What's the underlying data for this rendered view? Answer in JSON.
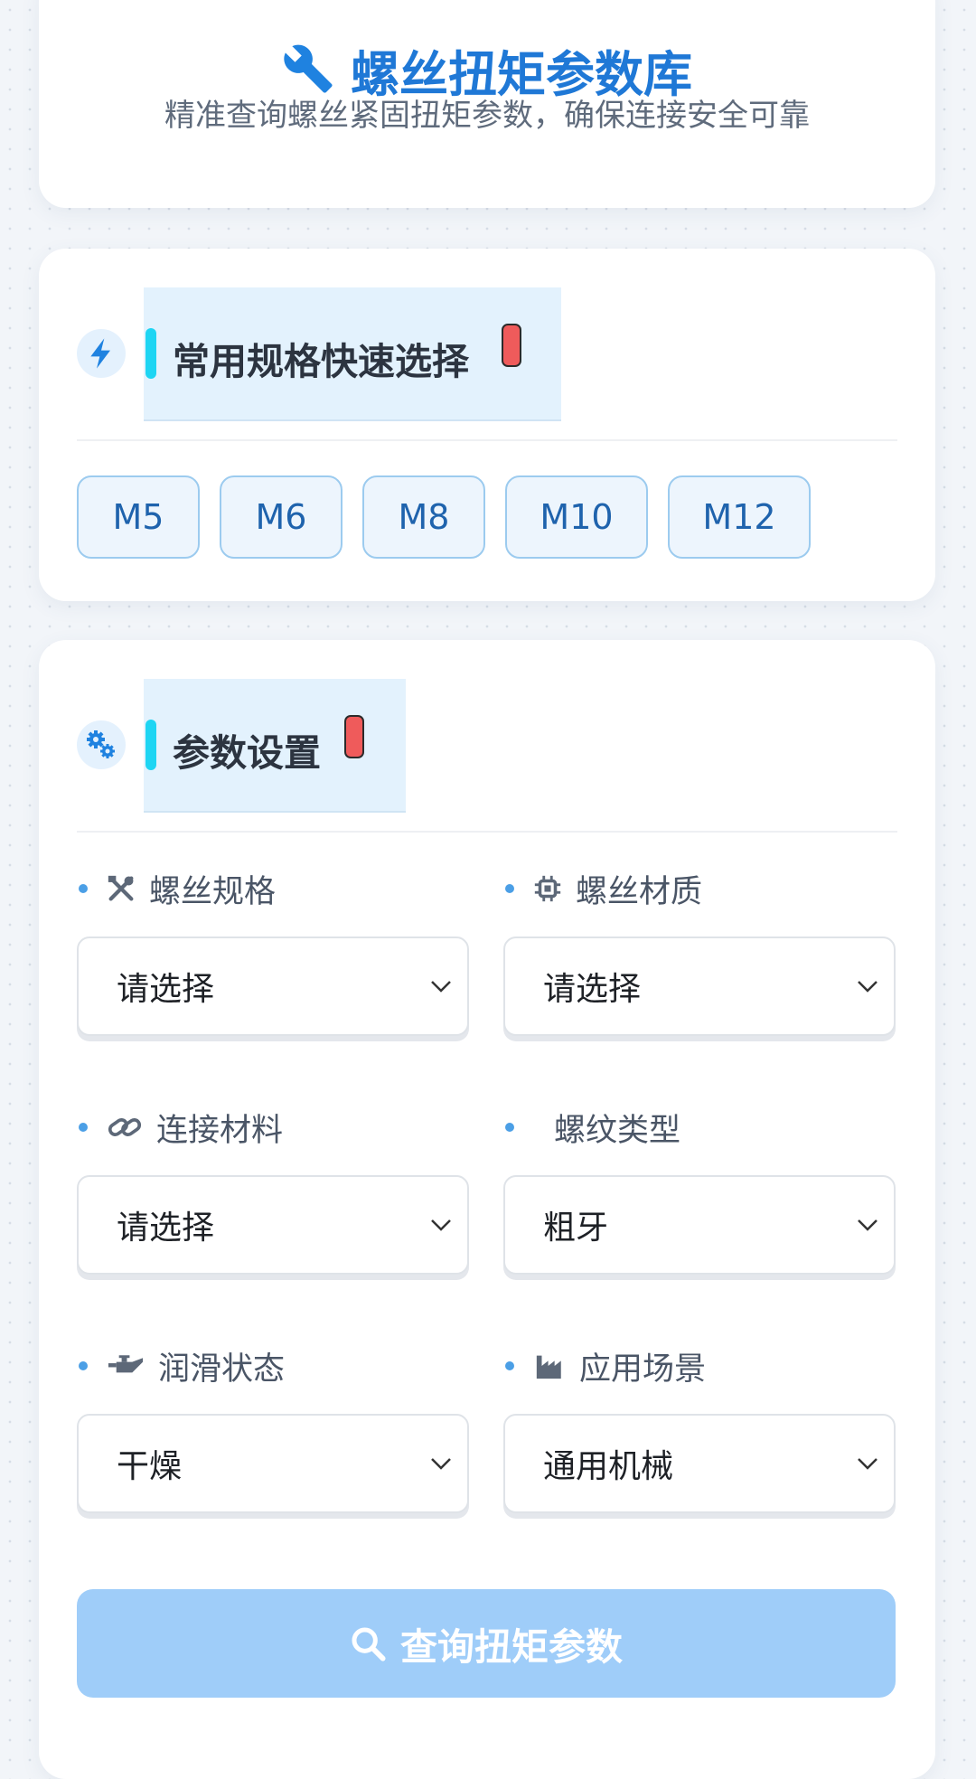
{
  "header": {
    "title": "螺丝扭矩参数库",
    "subtitle": "精准查询螺丝紧固扭矩参数，确保连接安全可靠",
    "icon": "wrench-icon"
  },
  "quick_select": {
    "title": "常用规格快速选择",
    "icon": "lightning-icon",
    "chips": [
      "M5",
      "M6",
      "M8",
      "M10",
      "M12"
    ]
  },
  "params": {
    "title": "参数设置",
    "icon": "gears-icon",
    "fields": [
      {
        "label": "螺丝规格",
        "icon": "tools-icon",
        "value": "请选择"
      },
      {
        "label": "螺丝材质",
        "icon": "chip-icon",
        "value": "请选择"
      },
      {
        "label": "连接材料",
        "icon": "link-icon",
        "value": "请选择"
      },
      {
        "label": "螺纹类型",
        "icon": "",
        "value": "粗牙"
      },
      {
        "label": "润滑状态",
        "icon": "oil-can-icon",
        "value": "干燥"
      },
      {
        "label": "应用场景",
        "icon": "factory-icon",
        "value": "通用机械"
      }
    ],
    "query_button": "查询扭矩参数"
  },
  "colors": {
    "accent": "#1f78d6",
    "chip_border": "#9ccbef",
    "button_disabled": "#9fcdf9",
    "badge_red": "#ef5b5b",
    "section_bar": "#1ed5f3"
  }
}
